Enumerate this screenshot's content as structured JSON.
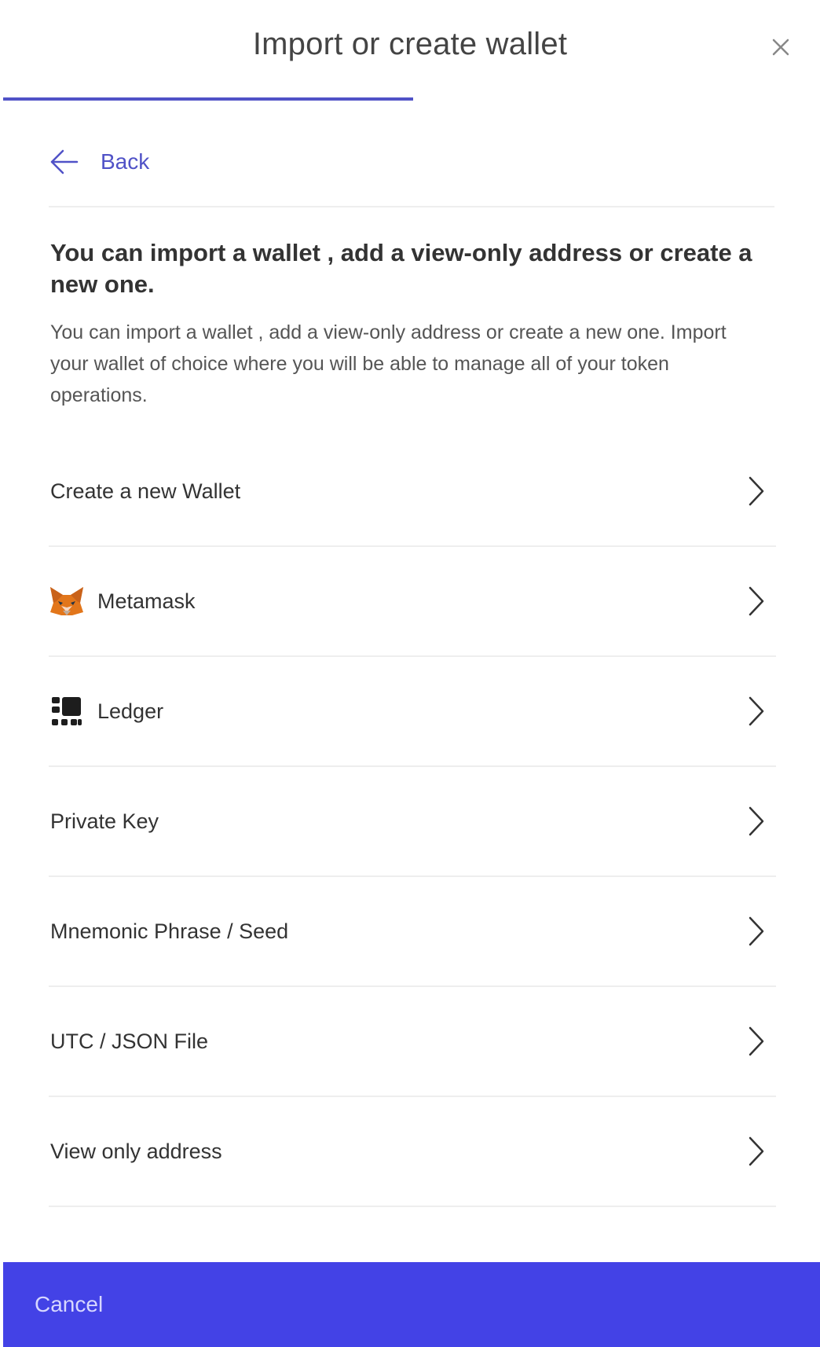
{
  "header": {
    "title": "Import or create wallet",
    "progress_percent": 50
  },
  "back": {
    "label": "Back"
  },
  "intro": {
    "heading": "You can import a wallet , add a view-only address or create a new one.",
    "description": "You can import a wallet , add a view-only address or create a new one. Import your wallet of choice where you will be able to manage all of your token operations."
  },
  "options": [
    {
      "label": "Create a new Wallet",
      "icon": null
    },
    {
      "label": "Metamask",
      "icon": "metamask-fox-icon"
    },
    {
      "label": "Ledger",
      "icon": "ledger-icon"
    },
    {
      "label": "Private Key",
      "icon": null
    },
    {
      "label": "Mnemonic Phrase / Seed",
      "icon": null
    },
    {
      "label": "UTC / JSON File",
      "icon": null
    },
    {
      "label": "View only address",
      "icon": null
    }
  ],
  "footer": {
    "cancel_label": "Cancel"
  },
  "colors": {
    "accent": "#5052c7",
    "footer_bg": "#4342e6",
    "footer_text": "#d7d7ff",
    "divider": "#eeeeee"
  }
}
